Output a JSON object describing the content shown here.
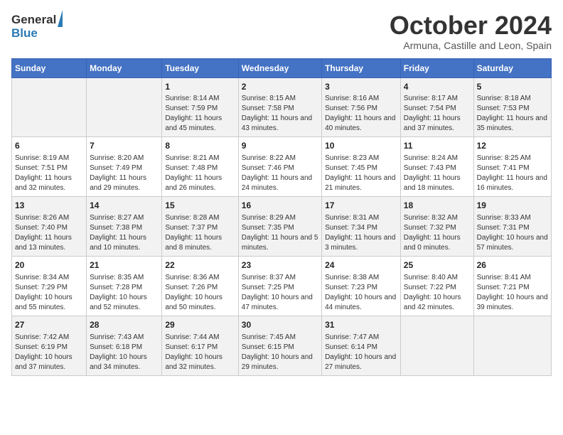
{
  "header": {
    "logo_general": "General",
    "logo_blue": "Blue",
    "month_title": "October 2024",
    "subtitle": "Armuna, Castille and Leon, Spain"
  },
  "days_of_week": [
    "Sunday",
    "Monday",
    "Tuesday",
    "Wednesday",
    "Thursday",
    "Friday",
    "Saturday"
  ],
  "weeks": [
    [
      {
        "day": "",
        "info": ""
      },
      {
        "day": "",
        "info": ""
      },
      {
        "day": "1",
        "info": "Sunrise: 8:14 AM\nSunset: 7:59 PM\nDaylight: 11 hours and 45 minutes."
      },
      {
        "day": "2",
        "info": "Sunrise: 8:15 AM\nSunset: 7:58 PM\nDaylight: 11 hours and 43 minutes."
      },
      {
        "day": "3",
        "info": "Sunrise: 8:16 AM\nSunset: 7:56 PM\nDaylight: 11 hours and 40 minutes."
      },
      {
        "day": "4",
        "info": "Sunrise: 8:17 AM\nSunset: 7:54 PM\nDaylight: 11 hours and 37 minutes."
      },
      {
        "day": "5",
        "info": "Sunrise: 8:18 AM\nSunset: 7:53 PM\nDaylight: 11 hours and 35 minutes."
      }
    ],
    [
      {
        "day": "6",
        "info": "Sunrise: 8:19 AM\nSunset: 7:51 PM\nDaylight: 11 hours and 32 minutes."
      },
      {
        "day": "7",
        "info": "Sunrise: 8:20 AM\nSunset: 7:49 PM\nDaylight: 11 hours and 29 minutes."
      },
      {
        "day": "8",
        "info": "Sunrise: 8:21 AM\nSunset: 7:48 PM\nDaylight: 11 hours and 26 minutes."
      },
      {
        "day": "9",
        "info": "Sunrise: 8:22 AM\nSunset: 7:46 PM\nDaylight: 11 hours and 24 minutes."
      },
      {
        "day": "10",
        "info": "Sunrise: 8:23 AM\nSunset: 7:45 PM\nDaylight: 11 hours and 21 minutes."
      },
      {
        "day": "11",
        "info": "Sunrise: 8:24 AM\nSunset: 7:43 PM\nDaylight: 11 hours and 18 minutes."
      },
      {
        "day": "12",
        "info": "Sunrise: 8:25 AM\nSunset: 7:41 PM\nDaylight: 11 hours and 16 minutes."
      }
    ],
    [
      {
        "day": "13",
        "info": "Sunrise: 8:26 AM\nSunset: 7:40 PM\nDaylight: 11 hours and 13 minutes."
      },
      {
        "day": "14",
        "info": "Sunrise: 8:27 AM\nSunset: 7:38 PM\nDaylight: 11 hours and 10 minutes."
      },
      {
        "day": "15",
        "info": "Sunrise: 8:28 AM\nSunset: 7:37 PM\nDaylight: 11 hours and 8 minutes."
      },
      {
        "day": "16",
        "info": "Sunrise: 8:29 AM\nSunset: 7:35 PM\nDaylight: 11 hours and 5 minutes."
      },
      {
        "day": "17",
        "info": "Sunrise: 8:31 AM\nSunset: 7:34 PM\nDaylight: 11 hours and 3 minutes."
      },
      {
        "day": "18",
        "info": "Sunrise: 8:32 AM\nSunset: 7:32 PM\nDaylight: 11 hours and 0 minutes."
      },
      {
        "day": "19",
        "info": "Sunrise: 8:33 AM\nSunset: 7:31 PM\nDaylight: 10 hours and 57 minutes."
      }
    ],
    [
      {
        "day": "20",
        "info": "Sunrise: 8:34 AM\nSunset: 7:29 PM\nDaylight: 10 hours and 55 minutes."
      },
      {
        "day": "21",
        "info": "Sunrise: 8:35 AM\nSunset: 7:28 PM\nDaylight: 10 hours and 52 minutes."
      },
      {
        "day": "22",
        "info": "Sunrise: 8:36 AM\nSunset: 7:26 PM\nDaylight: 10 hours and 50 minutes."
      },
      {
        "day": "23",
        "info": "Sunrise: 8:37 AM\nSunset: 7:25 PM\nDaylight: 10 hours and 47 minutes."
      },
      {
        "day": "24",
        "info": "Sunrise: 8:38 AM\nSunset: 7:23 PM\nDaylight: 10 hours and 44 minutes."
      },
      {
        "day": "25",
        "info": "Sunrise: 8:40 AM\nSunset: 7:22 PM\nDaylight: 10 hours and 42 minutes."
      },
      {
        "day": "26",
        "info": "Sunrise: 8:41 AM\nSunset: 7:21 PM\nDaylight: 10 hours and 39 minutes."
      }
    ],
    [
      {
        "day": "27",
        "info": "Sunrise: 7:42 AM\nSunset: 6:19 PM\nDaylight: 10 hours and 37 minutes."
      },
      {
        "day": "28",
        "info": "Sunrise: 7:43 AM\nSunset: 6:18 PM\nDaylight: 10 hours and 34 minutes."
      },
      {
        "day": "29",
        "info": "Sunrise: 7:44 AM\nSunset: 6:17 PM\nDaylight: 10 hours and 32 minutes."
      },
      {
        "day": "30",
        "info": "Sunrise: 7:45 AM\nSunset: 6:15 PM\nDaylight: 10 hours and 29 minutes."
      },
      {
        "day": "31",
        "info": "Sunrise: 7:47 AM\nSunset: 6:14 PM\nDaylight: 10 hours and 27 minutes."
      },
      {
        "day": "",
        "info": ""
      },
      {
        "day": "",
        "info": ""
      }
    ]
  ]
}
